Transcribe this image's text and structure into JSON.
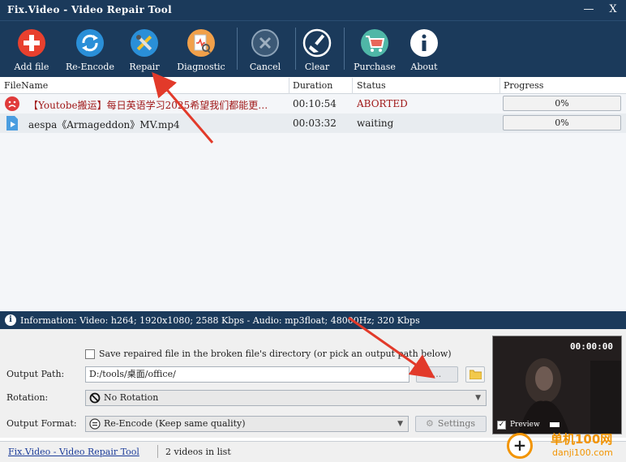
{
  "window": {
    "title": "Fix.Video - Video Repair Tool",
    "minimize": "—",
    "close": "X"
  },
  "toolbar": {
    "add_file": "Add file",
    "re_encode": "Re-Encode",
    "repair": "Repair",
    "diagnostic": "Diagnostic",
    "cancel": "Cancel",
    "clear": "Clear",
    "purchase": "Purchase",
    "about": "About"
  },
  "list": {
    "headers": {
      "filename": "FileName",
      "duration": "Duration",
      "status": "Status",
      "progress": "Progress"
    },
    "rows": [
      {
        "filename": "【Youtobe搬运】每日英语学习2025希望我们都能更…",
        "duration": "00:10:54",
        "status": "ABORTED",
        "progress": "0%",
        "status_color": "#a01818"
      },
      {
        "filename": "aespa《Armageddon》MV.mp4",
        "duration": "00:03:32",
        "status": "waiting",
        "progress": "0%"
      }
    ]
  },
  "info": {
    "text": "Information: Video: h264; 1920x1080; 2588 Kbps - Audio: mp3float; 48000Hz; 320 Kbps"
  },
  "settings": {
    "save_checkbox_label": "Save repaired file in the broken file's directory (or pick an output path below)",
    "output_path_label": "Output Path:",
    "output_path_value": "D:/tools/桌面/office/",
    "browse": "...",
    "rotation_label": "Rotation:",
    "rotation_value": "No Rotation",
    "format_label": "Output Format:",
    "format_value": "Re-Encode (Keep same quality)",
    "settings_button": "Settings"
  },
  "preview": {
    "time": "00:00:00",
    "label": "Preview"
  },
  "status": {
    "link": "Fix.Video - Video Repair Tool",
    "count": "2 videos in list"
  },
  "watermark": {
    "line1": "单机100网",
    "line2": "danji100.com"
  },
  "colors": {
    "accent": "#1b3a5b",
    "aborted": "#a01818",
    "arrow": "#e23a2a"
  }
}
